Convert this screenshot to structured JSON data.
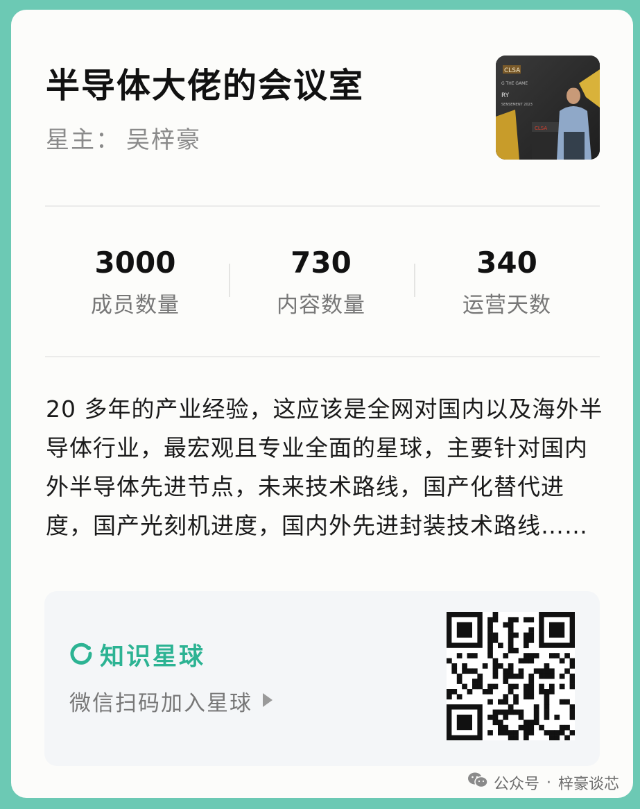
{
  "header": {
    "title": "半导体大佬的会议室",
    "owner_label": "星主：",
    "owner_name": "吴梓豪"
  },
  "avatar": {
    "icon": "speaker-photo",
    "logo_text": "CLSA",
    "slide_text_1": "G THE GAME",
    "slide_text_2": "RY",
    "slide_text_3": "SENSEMENT 2023",
    "podium_text": "CLSA"
  },
  "stats": [
    {
      "value": "3000",
      "label": "成员数量"
    },
    {
      "value": "730",
      "label": "内容数量"
    },
    {
      "value": "340",
      "label": "运营天数"
    }
  ],
  "description": "20 多年的产业经验，这应该是全网对国内以及海外半导体行业，最宏观且专业全面的星球，主要针对国内外半导体先进节点，未来技术路线，国产化替代进度，国产光刻机进度，国内外先进封装技术路线……",
  "join_panel": {
    "brand_name": "知识星球",
    "brand_color": "#2cb393",
    "scan_text": "微信扫码加入星球",
    "qr_icon": "qr-code"
  },
  "footer": {
    "platform": "公众号",
    "separator": "·",
    "account": "梓豪谈芯"
  }
}
